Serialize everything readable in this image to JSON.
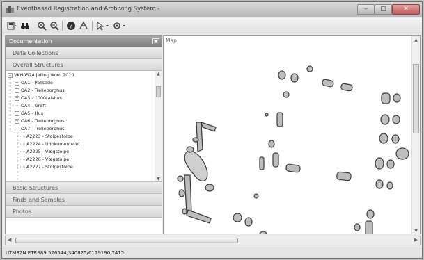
{
  "window": {
    "title": "Eventbased Registration and Archiving System - "
  },
  "toolbar": {
    "icons": [
      "save-menu-icon",
      "binoculars-icon",
      "zoom-in-icon",
      "zoom-out-icon",
      "help-icon",
      "pan-icon",
      "select-menu-icon",
      "tools-menu-icon"
    ]
  },
  "left_panel": {
    "header": "Documentation",
    "sections": {
      "data_collections": "Data Collections",
      "overall_structures": "Overall Structures",
      "basic_structures": "Basic Structures",
      "finds_and_samples": "Finds and Samples",
      "photos": "Photos"
    },
    "tree": [
      {
        "label": "VKH0524 Jelling Nord 2010",
        "expander": "minus"
      },
      {
        "label": "OA1 - Palisade",
        "expander": "plus"
      },
      {
        "label": "OA2 - Trelleborghus",
        "expander": "plus"
      },
      {
        "label": "OA3 - 1000talshus",
        "expander": "plus"
      },
      {
        "label": "OA4 - Grøft",
        "expander": "none"
      },
      {
        "label": "OA5 - Hus",
        "expander": "plus"
      },
      {
        "label": "OA6 - Trelleborghus",
        "expander": "plus"
      },
      {
        "label": "OA7 - Trelleborghus",
        "expander": "minus"
      },
      {
        "label": "A2223 - Stolpestolpe",
        "expander": "none"
      },
      {
        "label": "A2224 - Udokumenteret",
        "expander": "none"
      },
      {
        "label": "A2225 - Vægstolpe",
        "expander": "none"
      },
      {
        "label": "A2226 - Vægstolpe",
        "expander": "none"
      },
      {
        "label": "A2227 - Stolpestolpe",
        "expander": "none"
      }
    ]
  },
  "map": {
    "title": "Map"
  },
  "status": {
    "text": "UTM32N ETRS89  526544,340825/6179190,7415"
  }
}
